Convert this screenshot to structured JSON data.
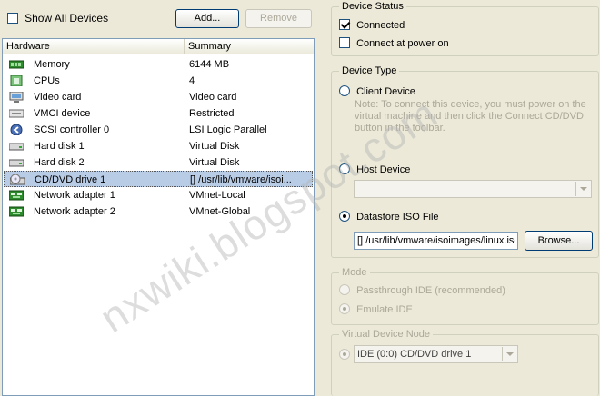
{
  "toolbar": {
    "show_all_devices_label": "Show All Devices",
    "show_all_devices_checked": false,
    "add_label": "Add...",
    "remove_label": "Remove"
  },
  "hardware_table": {
    "columns": [
      "Hardware",
      "Summary"
    ],
    "rows": [
      {
        "name": "Memory",
        "summary": "6144 MB",
        "icon": "memory-icon"
      },
      {
        "name": "CPUs",
        "summary": "4",
        "icon": "cpu-icon"
      },
      {
        "name": "Video card",
        "summary": "Video card",
        "icon": "video-card-icon"
      },
      {
        "name": "VMCI device",
        "summary": "Restricted",
        "icon": "vmci-device-icon"
      },
      {
        "name": "SCSI controller 0",
        "summary": "LSI Logic Parallel",
        "icon": "scsi-controller-icon"
      },
      {
        "name": "Hard disk 1",
        "summary": "Virtual Disk",
        "icon": "hard-disk-icon"
      },
      {
        "name": "Hard disk 2",
        "summary": "Virtual Disk",
        "icon": "hard-disk-icon"
      },
      {
        "name": "CD/DVD drive 1",
        "summary": "[] /usr/lib/vmware/isoi...",
        "icon": "cd-dvd-drive-icon",
        "selected": true
      },
      {
        "name": "Network adapter 1",
        "summary": "VMnet-Local",
        "icon": "network-adapter-icon"
      },
      {
        "name": "Network adapter 2",
        "summary": "VMnet-Global",
        "icon": "network-adapter-icon"
      }
    ]
  },
  "device_status": {
    "title": "Device Status",
    "connected_label": "Connected",
    "connected_checked": true,
    "connect_at_power_on_label": "Connect at power on",
    "connect_at_power_on_checked": false
  },
  "device_type": {
    "title": "Device Type",
    "client_device_label": "Client Device",
    "client_device_note": "Note: To connect this device, you must power on the virtual machine and then click the Connect CD/DVD button in the toolbar.",
    "host_device_label": "Host Device",
    "host_device_value": "",
    "datastore_iso_label": "Datastore ISO File",
    "datastore_iso_value": "[] /usr/lib/vmware/isoimages/linux.iso",
    "browse_label": "Browse...",
    "selected": "datastore_iso"
  },
  "mode": {
    "title": "Mode",
    "passthrough_label": "Passthrough IDE (recommended)",
    "emulate_label": "Emulate IDE",
    "selected": "emulate"
  },
  "virtual_device_node": {
    "title": "Virtual Device Node",
    "value": "IDE (0:0) CD/DVD drive 1"
  },
  "watermark": "nxwiki.blogspot.com"
}
